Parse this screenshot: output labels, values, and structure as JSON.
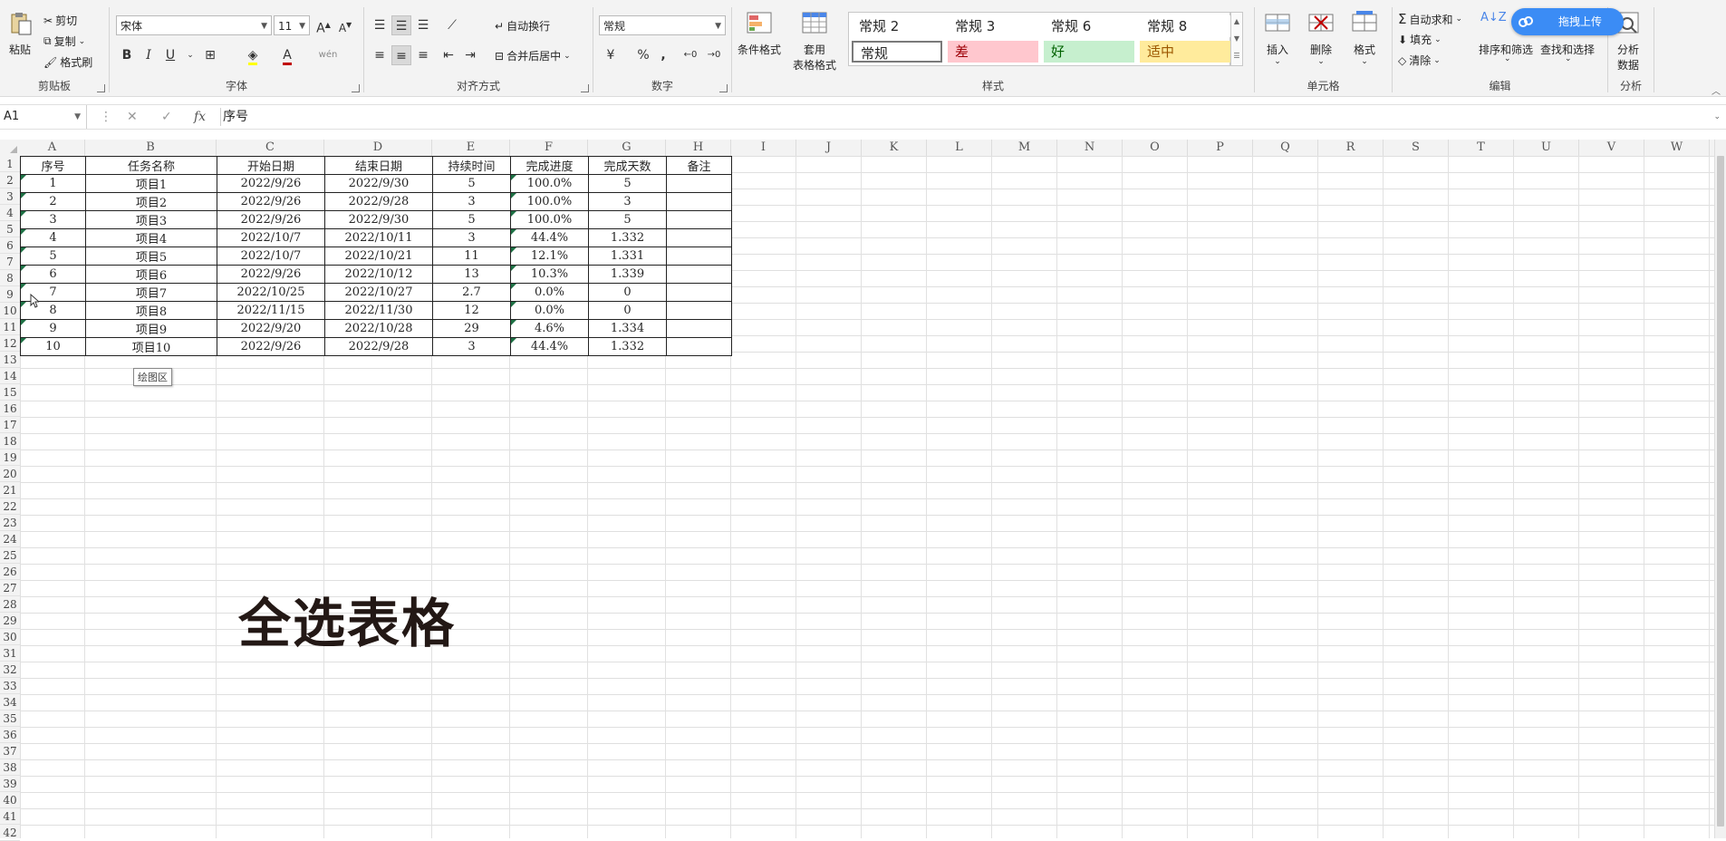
{
  "ribbon": {
    "clipboard": {
      "paste": "粘贴",
      "cut": "剪切",
      "copy": "复制",
      "format_painter": "格式刷",
      "label": "剪贴板"
    },
    "font": {
      "name": "宋体",
      "size": "11",
      "bold": "B",
      "italic": "I",
      "underline": "U",
      "label": "字体"
    },
    "alignment": {
      "wrap": "自动换行",
      "merge": "合并后居中",
      "label": "对齐方式"
    },
    "number": {
      "format": "常规",
      "percent": "%",
      "comma": ",",
      "label": "数字"
    },
    "styles": {
      "conditional": "条件格式",
      "table_format_1": "套用",
      "table_format_2": "表格格式",
      "cells": [
        {
          "text": "常规 2",
          "bg": "#ffffff",
          "color": "#262626"
        },
        {
          "text": "常规 3",
          "bg": "#ffffff",
          "color": "#262626"
        },
        {
          "text": "常规 6",
          "bg": "#ffffff",
          "color": "#262626"
        },
        {
          "text": "常规 8",
          "bg": "#ffffff",
          "color": "#262626"
        },
        {
          "text": "常规",
          "bg": "#ffffff",
          "color": "#262626"
        },
        {
          "text": "差",
          "bg": "#ffc7ce",
          "color": "#9c0006"
        },
        {
          "text": "好",
          "bg": "#c6efce",
          "color": "#006100"
        },
        {
          "text": "适中",
          "bg": "#ffeb9c",
          "color": "#9c5700"
        }
      ],
      "label": "样式"
    },
    "cells": {
      "insert": "插入",
      "delete": "删除",
      "format": "格式",
      "label": "单元格"
    },
    "editing": {
      "autosum": "自动求和",
      "fill": "填充",
      "clear": "清除",
      "sort": "排序和筛选",
      "find": "查找和选择",
      "label": "编辑"
    },
    "analysis": {
      "line1": "分析",
      "line2": "数据",
      "label": "分析"
    }
  },
  "upload_button": "拖拽上传",
  "formula_bar": {
    "namebox": "A1",
    "content": "序号",
    "fx": "fx"
  },
  "columns": [
    "A",
    "B",
    "C",
    "D",
    "E",
    "F",
    "G",
    "H",
    "I",
    "J",
    "K",
    "L",
    "M",
    "N",
    "O",
    "P",
    "Q",
    "R",
    "S",
    "T",
    "U",
    "V",
    "W"
  ],
  "rows": [
    "1",
    "2",
    "3",
    "4",
    "5",
    "6",
    "7",
    "8",
    "9",
    "10",
    "11",
    "12",
    "13",
    "14",
    "15",
    "16",
    "17",
    "18",
    "19",
    "20",
    "21",
    "22",
    "23",
    "24",
    "25",
    "26",
    "27",
    "28",
    "29",
    "30",
    "31",
    "32",
    "33",
    "34",
    "35",
    "36",
    "37",
    "38",
    "39",
    "40",
    "41",
    "42"
  ],
  "table": {
    "headers": [
      "序号",
      "任务名称",
      "开始日期",
      "结束日期",
      "持续时间",
      "完成进度",
      "完成天数",
      "备注"
    ],
    "rows": [
      [
        "1",
        "项目1",
        "2022/9/26",
        "2022/9/30",
        "5",
        "100.0%",
        "5",
        ""
      ],
      [
        "2",
        "项目2",
        "2022/9/26",
        "2022/9/28",
        "3",
        "100.0%",
        "3",
        ""
      ],
      [
        "3",
        "项目3",
        "2022/9/26",
        "2022/9/30",
        "5",
        "100.0%",
        "5",
        ""
      ],
      [
        "4",
        "项目4",
        "2022/10/7",
        "2022/10/11",
        "3",
        "44.4%",
        "1.332",
        ""
      ],
      [
        "5",
        "项目5",
        "2022/10/7",
        "2022/10/21",
        "11",
        "12.1%",
        "1.331",
        ""
      ],
      [
        "6",
        "项目6",
        "2022/9/26",
        "2022/10/12",
        "13",
        "10.3%",
        "1.339",
        ""
      ],
      [
        "7",
        "项目7",
        "2022/10/25",
        "2022/10/27",
        "2.7",
        "0.0%",
        "0",
        ""
      ],
      [
        "8",
        "项目8",
        "2022/11/15",
        "2022/11/30",
        "12",
        "0.0%",
        "0",
        ""
      ],
      [
        "9",
        "项目9",
        "2022/9/20",
        "2022/10/28",
        "29",
        "4.6%",
        "1.334",
        ""
      ],
      [
        "10",
        "项目10",
        "2022/9/26",
        "2022/9/28",
        "3",
        "44.4%",
        "1.332",
        ""
      ]
    ]
  },
  "tooltip": "绘图区",
  "overlay_text": "全选表格",
  "colors": {
    "accent": "#1e7145",
    "upload": "#3b8cf5"
  }
}
